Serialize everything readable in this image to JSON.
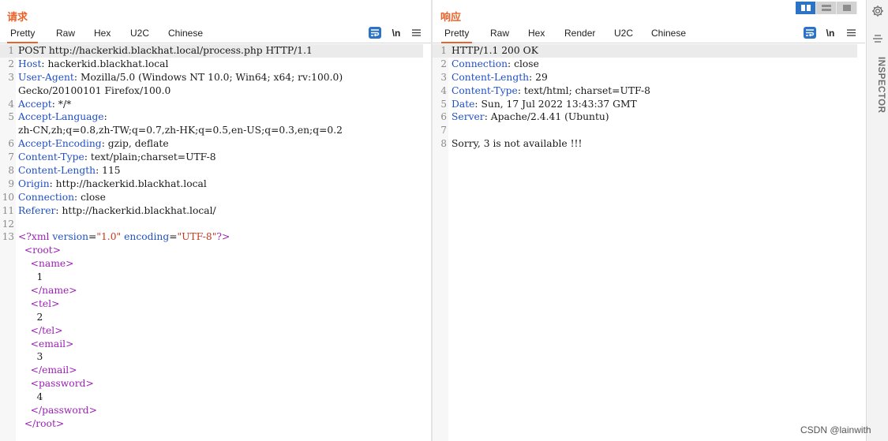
{
  "request": {
    "title": "请求",
    "tabs": [
      "Pretty",
      "Raw",
      "Hex",
      "U2C",
      "Chinese"
    ],
    "active_tab": "Pretty",
    "newline_label": "\\n",
    "lines": [
      {
        "n": "1",
        "parts": [
          {
            "t": "POST http://hackerkid.blackhat.local/process.php HTTP/1.1",
            "c": ""
          }
        ]
      },
      {
        "n": "2",
        "parts": [
          {
            "t": "Host",
            "c": "k"
          },
          {
            "t": ": hackerkid.blackhat.local",
            "c": ""
          }
        ]
      },
      {
        "n": "3",
        "parts": [
          {
            "t": "User-Agent",
            "c": "k"
          },
          {
            "t": ": Mozilla/5.0 (Windows NT 10.0; Win64; x64; rv:100.0)",
            "c": ""
          }
        ]
      },
      {
        "n": "",
        "parts": [
          {
            "t": "Gecko/20100101 Firefox/100.0",
            "c": ""
          }
        ]
      },
      {
        "n": "4",
        "parts": [
          {
            "t": "Accept",
            "c": "k"
          },
          {
            "t": ": */*",
            "c": ""
          }
        ]
      },
      {
        "n": "5",
        "parts": [
          {
            "t": "Accept-Language",
            "c": "k"
          },
          {
            "t": ":",
            "c": ""
          }
        ]
      },
      {
        "n": "",
        "parts": [
          {
            "t": "zh-CN,zh;q=0.8,zh-TW;q=0.7,zh-HK;q=0.5,en-US;q=0.3,en;q=0.2",
            "c": ""
          }
        ]
      },
      {
        "n": "6",
        "parts": [
          {
            "t": "Accept-Encoding",
            "c": "k"
          },
          {
            "t": ": gzip, deflate",
            "c": ""
          }
        ]
      },
      {
        "n": "7",
        "parts": [
          {
            "t": "Content-Type",
            "c": "k"
          },
          {
            "t": ": text/plain;charset=UTF-8",
            "c": ""
          }
        ]
      },
      {
        "n": "8",
        "parts": [
          {
            "t": "Content-Length",
            "c": "k"
          },
          {
            "t": ": 115",
            "c": ""
          }
        ]
      },
      {
        "n": "9",
        "parts": [
          {
            "t": "Origin",
            "c": "k"
          },
          {
            "t": ": http://hackerkid.blackhat.local",
            "c": ""
          }
        ]
      },
      {
        "n": "10",
        "parts": [
          {
            "t": "Connection",
            "c": "k"
          },
          {
            "t": ": close",
            "c": ""
          }
        ]
      },
      {
        "n": "11",
        "parts": [
          {
            "t": "Referer",
            "c": "k"
          },
          {
            "t": ": http://hackerkid.blackhat.local/",
            "c": ""
          }
        ]
      },
      {
        "n": "12",
        "parts": [
          {
            "t": "",
            "c": ""
          }
        ]
      },
      {
        "n": "13",
        "parts": [
          {
            "t": "<?xml ",
            "c": "tag"
          },
          {
            "t": "version",
            "c": "attr"
          },
          {
            "t": "=",
            "c": ""
          },
          {
            "t": "\"1.0\"",
            "c": "str"
          },
          {
            "t": " ",
            "c": ""
          },
          {
            "t": "encoding",
            "c": "attr"
          },
          {
            "t": "=",
            "c": ""
          },
          {
            "t": "\"UTF-8\"",
            "c": "str"
          },
          {
            "t": "?>",
            "c": "tag"
          }
        ]
      },
      {
        "n": "",
        "parts": [
          {
            "t": "  <root>",
            "c": "tag"
          }
        ]
      },
      {
        "n": "",
        "parts": [
          {
            "t": "    <name>",
            "c": "tag"
          }
        ]
      },
      {
        "n": "",
        "parts": [
          {
            "t": "      1",
            "c": ""
          }
        ]
      },
      {
        "n": "",
        "parts": [
          {
            "t": "    </name>",
            "c": "tag"
          }
        ]
      },
      {
        "n": "",
        "parts": [
          {
            "t": "    <tel>",
            "c": "tag"
          }
        ]
      },
      {
        "n": "",
        "parts": [
          {
            "t": "      2",
            "c": ""
          }
        ]
      },
      {
        "n": "",
        "parts": [
          {
            "t": "    </tel>",
            "c": "tag"
          }
        ]
      },
      {
        "n": "",
        "parts": [
          {
            "t": "    <email>",
            "c": "tag"
          }
        ]
      },
      {
        "n": "",
        "parts": [
          {
            "t": "      3",
            "c": ""
          }
        ]
      },
      {
        "n": "",
        "parts": [
          {
            "t": "    </email>",
            "c": "tag"
          }
        ]
      },
      {
        "n": "",
        "parts": [
          {
            "t": "    <password>",
            "c": "tag"
          }
        ]
      },
      {
        "n": "",
        "parts": [
          {
            "t": "      4",
            "c": ""
          }
        ]
      },
      {
        "n": "",
        "parts": [
          {
            "t": "    </password>",
            "c": "tag"
          }
        ]
      },
      {
        "n": "",
        "parts": [
          {
            "t": "  </root>",
            "c": "tag"
          }
        ]
      }
    ]
  },
  "response": {
    "title": "响应",
    "tabs": [
      "Pretty",
      "Raw",
      "Hex",
      "Render",
      "U2C",
      "Chinese"
    ],
    "active_tab": "Pretty",
    "newline_label": "\\n",
    "lines": [
      {
        "n": "1",
        "parts": [
          {
            "t": "HTTP/1.1 200 OK",
            "c": ""
          }
        ]
      },
      {
        "n": "2",
        "parts": [
          {
            "t": "Connection",
            "c": "k"
          },
          {
            "t": ": close",
            "c": ""
          }
        ]
      },
      {
        "n": "3",
        "parts": [
          {
            "t": "Content-Length",
            "c": "k"
          },
          {
            "t": ": 29",
            "c": ""
          }
        ]
      },
      {
        "n": "4",
        "parts": [
          {
            "t": "Content-Type",
            "c": "k"
          },
          {
            "t": ": text/html; charset=UTF-8",
            "c": ""
          }
        ]
      },
      {
        "n": "5",
        "parts": [
          {
            "t": "Date",
            "c": "k"
          },
          {
            "t": ": Sun, 17 Jul 2022 13:43:37 GMT",
            "c": ""
          }
        ]
      },
      {
        "n": "6",
        "parts": [
          {
            "t": "Server",
            "c": "k"
          },
          {
            "t": ": Apache/2.4.41 (Ubuntu)",
            "c": ""
          }
        ]
      },
      {
        "n": "7",
        "parts": [
          {
            "t": "",
            "c": ""
          }
        ]
      },
      {
        "n": "8",
        "parts": [
          {
            "t": "Sorry, 3 is not available !!!",
            "c": ""
          }
        ]
      }
    ]
  },
  "inspector": {
    "label": "INSPECTOR"
  },
  "icons": {
    "wrap": "wrap-lines-icon",
    "menu": "hamburger-menu-icon",
    "gear": "gear-icon",
    "side_lines": "lines-icon",
    "view_split": "split-view-icon",
    "view_horizontal": "horizontal-view-icon",
    "view_single": "single-view-icon"
  },
  "colors": {
    "accent": "#e8632b",
    "header_key": "#1f4fc5",
    "xml_tag": "#9b1fb5",
    "xml_string": "#c4391c",
    "toggle_on": "#2c72c7"
  },
  "watermark": "CSDN @lainwith"
}
